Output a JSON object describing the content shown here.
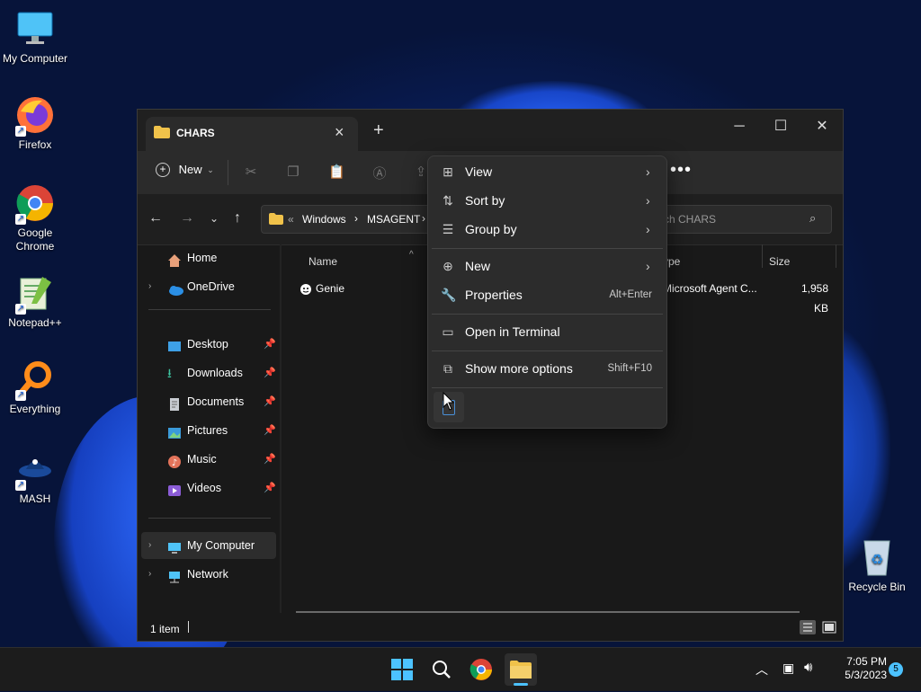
{
  "desktop": {
    "icons": [
      {
        "label": "My Computer"
      },
      {
        "label": "Firefox"
      },
      {
        "label": "Google Chrome"
      },
      {
        "label": "Notepad++"
      },
      {
        "label": "Everything"
      },
      {
        "label": "MASH"
      },
      {
        "label": "Recycle Bin"
      }
    ]
  },
  "explorer": {
    "tab_title": "CHARS",
    "toolbar": {
      "new_label": "New"
    },
    "address": {
      "prefix": "«",
      "crumbs": [
        "Windows",
        "MSAGENT"
      ]
    },
    "search_placeholder": "Search CHARS",
    "search_visible": "rch CHARS",
    "nav": {
      "home": "Home",
      "onedrive": "OneDrive",
      "quick": [
        "Desktop",
        "Downloads",
        "Documents",
        "Pictures",
        "Music",
        "Videos"
      ],
      "my_computer": "My Computer",
      "network": "Network"
    },
    "columns": {
      "name": "Name",
      "type": "ype",
      "size": "Size"
    },
    "files": [
      {
        "name": "Genie",
        "type": "Microsoft Agent C...",
        "size": "1,958 KB"
      }
    ],
    "status": "1 item"
  },
  "context_menu": {
    "items": [
      {
        "label": "View",
        "submenu": true
      },
      {
        "label": "Sort by",
        "submenu": true
      },
      {
        "label": "Group by",
        "submenu": true
      },
      {
        "label": "New",
        "submenu": true
      },
      {
        "label": "Properties",
        "shortcut": "Alt+Enter"
      },
      {
        "label": "Open in Terminal"
      },
      {
        "label": "Show more options",
        "shortcut": "Shift+F10"
      }
    ]
  },
  "taskbar": {
    "time": "7:05 PM",
    "date": "5/3/2023",
    "notification_count": "5"
  },
  "colors": {
    "accent": "#4cc2ff",
    "folder": "#f0c24a",
    "taskbar": "#1c1c1c",
    "menu": "#2c2c2c"
  }
}
